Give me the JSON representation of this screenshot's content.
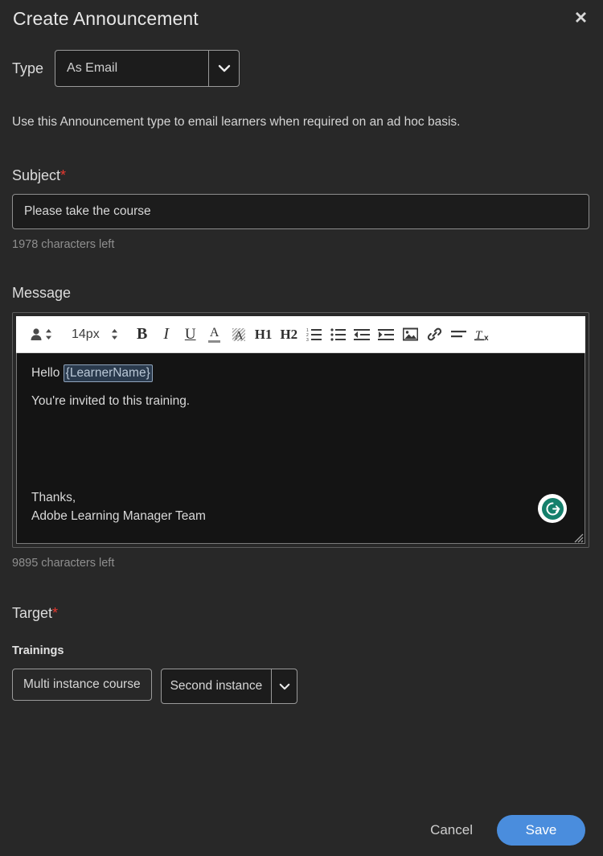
{
  "dialog": {
    "title": "Create Announcement",
    "close_icon": "close-icon"
  },
  "type_field": {
    "label": "Type",
    "value": "As Email",
    "options": [
      "As Email"
    ],
    "help_text": "Use this Announcement type to email learners when required on an ad hoc basis."
  },
  "subject": {
    "label": "Subject",
    "required_marker": "*",
    "value": "Please take the course",
    "placeholder": "",
    "counter": "1978 characters left"
  },
  "message": {
    "label": "Message",
    "counter": "9895 characters left",
    "toolbar": {
      "insert_token_label": "insert-token",
      "font_size": "14px",
      "bold": "B",
      "italic": "I",
      "underline": "U",
      "text_color": "A",
      "highlight": "A",
      "heading1": "H1",
      "heading2": "H2",
      "ordered_list": "ordered-list",
      "unordered_list": "unordered-list",
      "outdent": "outdent",
      "indent": "indent",
      "image": "image",
      "link": "link",
      "align": "align",
      "clear_format": "clear-format"
    },
    "content": {
      "greeting_prefix": "Hello ",
      "token": "{LearnerName}",
      "line2": "You're invited to this training.",
      "sign_off": "Thanks,",
      "signature": "Adobe Learning Manager Team"
    },
    "grammarly_icon_label": "G"
  },
  "target": {
    "label": "Target",
    "required_marker": "*",
    "trainings_label": "Trainings",
    "chips": [
      {
        "text": "Multi instance course",
        "type": "tag"
      }
    ],
    "instance_select": {
      "value": "Second instance",
      "options": [
        "Second instance"
      ]
    }
  },
  "footer": {
    "cancel_label": "Cancel",
    "save_label": "Save"
  },
  "colors": {
    "background": "#282828",
    "accent_blue": "#4a8ddd",
    "required_red": "#e8392f",
    "grammarly_green": "#15806c",
    "toolbar_white": "#ffffff"
  }
}
